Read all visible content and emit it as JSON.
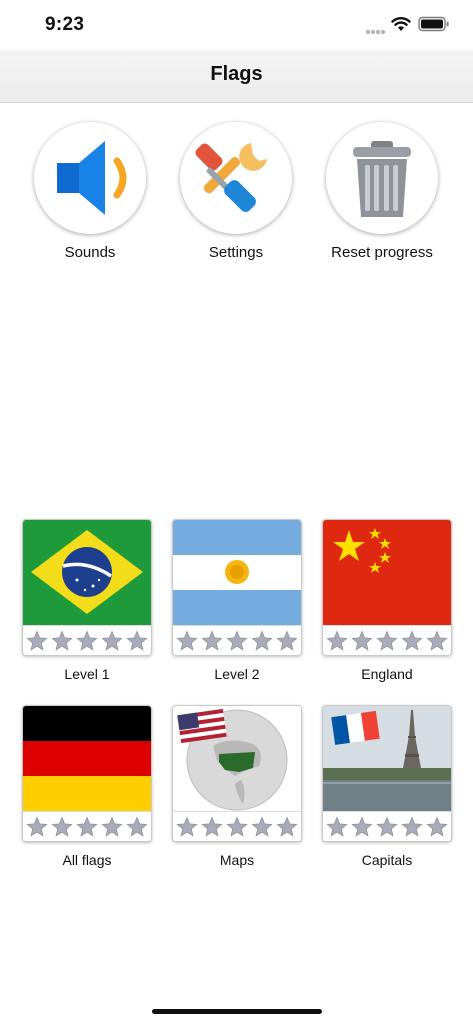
{
  "status_bar": {
    "time": "9:23"
  },
  "nav": {
    "title": "Flags"
  },
  "actions": [
    {
      "label": "Sounds",
      "icon": "speaker-icon"
    },
    {
      "label": "Settings",
      "icon": "tools-icon"
    },
    {
      "label": "Reset progress",
      "icon": "trash-icon"
    }
  ],
  "levels": [
    {
      "label": "Level 1",
      "image": "brazil-flag",
      "stars": 0
    },
    {
      "label": "Level 2",
      "image": "argentina-flag",
      "stars": 0
    },
    {
      "label": "England",
      "image": "china-flag",
      "stars": 0
    },
    {
      "label": "All flags",
      "image": "germany-flag",
      "stars": 0
    },
    {
      "label": "Maps",
      "image": "globe-map",
      "stars": 0
    },
    {
      "label": "Capitals",
      "image": "paris-eiffel-tower",
      "stars": 0
    }
  ],
  "colors": {
    "star_empty": "#a9acb8",
    "nav_bg": "#efefef",
    "accent_blue": "#1a83e8"
  }
}
